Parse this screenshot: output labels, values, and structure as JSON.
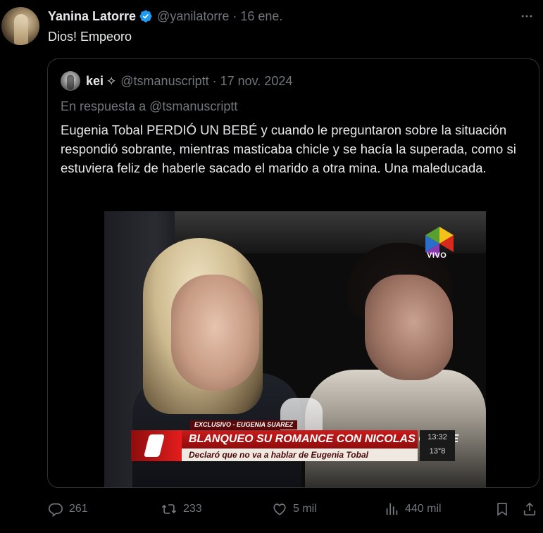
{
  "author": {
    "display_name": "Yanina Latorre",
    "handle": "@yanilatorre",
    "separator": "·",
    "date": "16 ene."
  },
  "tweet": {
    "text": "Dios! Empeoro"
  },
  "quoted": {
    "display_name": "kei",
    "sparkle": "✧",
    "handle": "@tsmanuscriptt",
    "separator": "·",
    "date": "17 nov. 2024",
    "reply_to": "En respuesta a @tsmanuscriptt",
    "text": "Eugenia Tobal PERDIÓ UN BEBÉ y cuando le preguntaron sobre la situación respondió sobrante, mientras masticaba chicle y se hacía la superada, como si estuviera feliz de haberle sacado el marido a otra mina. Una maleducada.",
    "video": {
      "channel_badge": "VIVO",
      "chyron_tag": "EXCLUSIVO - EUGENIA SUAREZ",
      "chyron_title": "BLANQUEO SU ROMANCE CON NICOLAS CABRE",
      "chyron_subtitle": "Declaró que no va a hablar de Eugenia Tobal",
      "clock": "13:32",
      "temperature": "13°8"
    }
  },
  "actions": {
    "replies": "261",
    "reposts": "233",
    "likes": "5 mil",
    "views": "440 mil"
  },
  "colors": {
    "background": "#000000",
    "text": "#e7e9ea",
    "muted": "#71767b",
    "border": "#2f3336",
    "verified": "#1d9bf0"
  },
  "icons": [
    "verified-badge-icon",
    "more-options-icon",
    "reply-icon",
    "repost-icon",
    "like-icon",
    "views-icon",
    "bookmark-icon",
    "share-icon"
  ]
}
